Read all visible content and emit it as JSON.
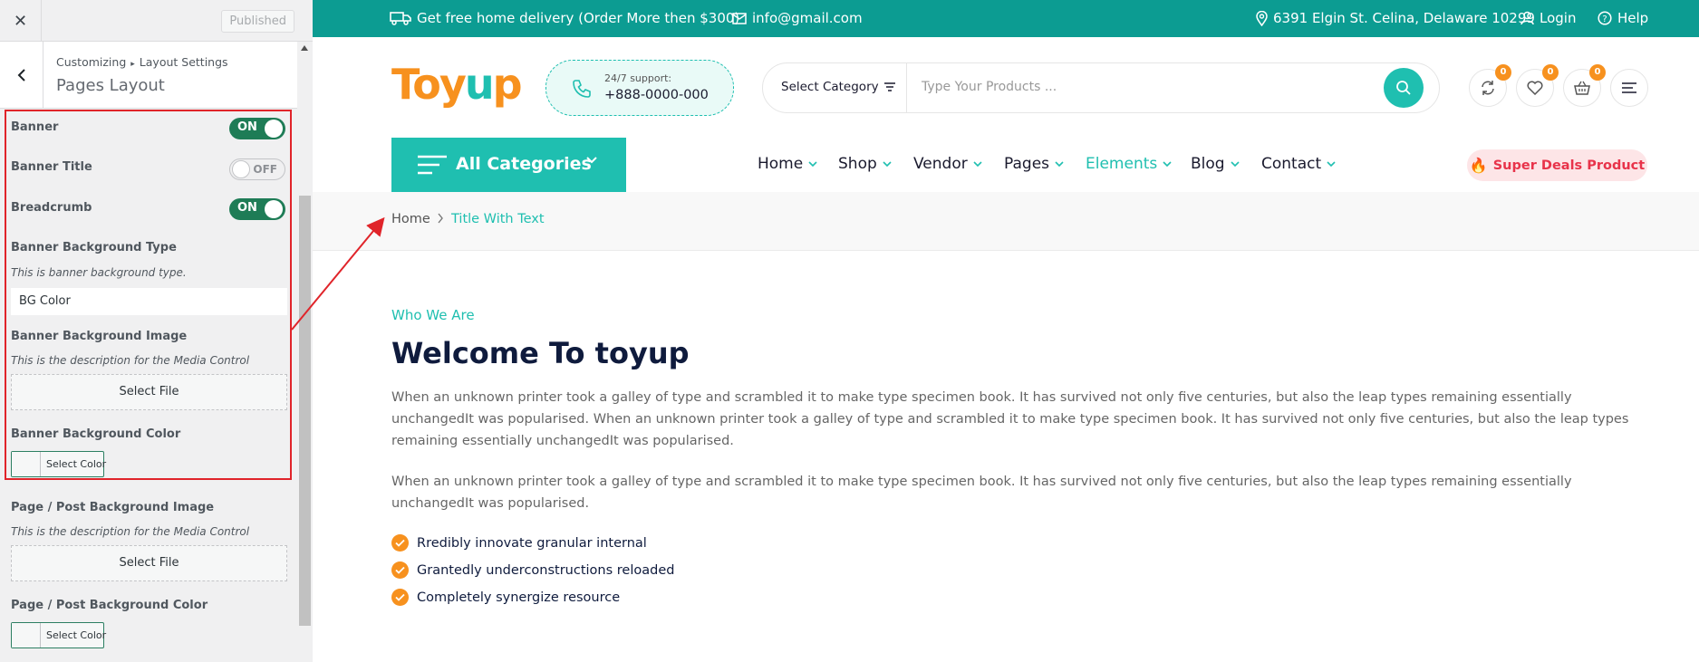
{
  "customizer": {
    "close_icon": "close-icon",
    "published_label": "Published",
    "breadcrumb_root": "Customizing",
    "breadcrumb_sep": "▸",
    "breadcrumb_section": "Layout Settings",
    "panel_title": "Pages Layout",
    "controls": {
      "banner_label": "Banner",
      "banner_state": "ON",
      "banner_title_label": "Banner Title",
      "banner_title_state": "OFF",
      "breadcrumb_label": "Breadcrumb",
      "breadcrumb_state": "ON",
      "bg_type_label": "Banner Background Type",
      "bg_type_desc": "This is banner background type.",
      "bg_type_value": "BG Color",
      "bg_image_label": "Banner Background Image",
      "bg_image_desc": "This is the description for the Media Control",
      "bg_image_button": "Select File",
      "bg_color_label": "Banner Background Color",
      "bg_color_button": "Select Color",
      "page_bg_image_label": "Page / Post Background Image",
      "page_bg_image_desc": "This is the description for the Media Control",
      "page_bg_image_button": "Select File",
      "page_bg_color_label": "Page / Post Background Color",
      "page_bg_color_button": "Select Color"
    }
  },
  "site": {
    "topbar": {
      "delivery": "Get free home delivery (Order More then $300)",
      "email": "info@gmail.com",
      "address": "6391 Elgin St. Celina, Delaware 10299",
      "login": "Login",
      "help": "Help"
    },
    "logo": {
      "part1": "Toy",
      "part2": "u",
      "part3": "p"
    },
    "support": {
      "label": "24/7 support:",
      "phone": "+888-0000-000"
    },
    "search": {
      "category": "Select Category",
      "placeholder": "Type Your Products ..."
    },
    "header_icons": {
      "compare_count": "0",
      "wishlist_count": "0",
      "cart_count": "0"
    },
    "all_categories": "All Categories",
    "nav": [
      "Home",
      "Shop",
      "Vendor",
      "Pages",
      "Elements",
      "Blog",
      "Contact"
    ],
    "deals": "Super Deals Product",
    "breadcrumb": {
      "home": "Home",
      "current": "Title With Text"
    },
    "content": {
      "eyebrow": "Who We Are",
      "heading": "Welcome To toyup",
      "para1": "When an unknown printer took a galley of type and scrambled it to make type specimen book. It has survived not only five centuries, but also the leap types remaining essentially unchangedIt was popularised. When an unknown printer took a galley of type and scrambled it to make type specimen book. It has survived not only five centuries, but also the leap types remaining essentially unchangedIt was popularised.",
      "para2": "When an unknown printer took a galley of type and scrambled it to make type specimen book. It has survived not only five centuries, but also the leap types remaining essentially unchangedIt was popularised.",
      "features": [
        "Rredibly innovate granular internal",
        "Grantedly underconstructions reloaded",
        "Completely synergize resource"
      ]
    }
  },
  "colors": {
    "teal": "#1fbfb0",
    "topbar": "#0c9c92",
    "orange": "#f7911e",
    "toggle_on": "#1e7c56",
    "annotation": "#e0242a"
  }
}
